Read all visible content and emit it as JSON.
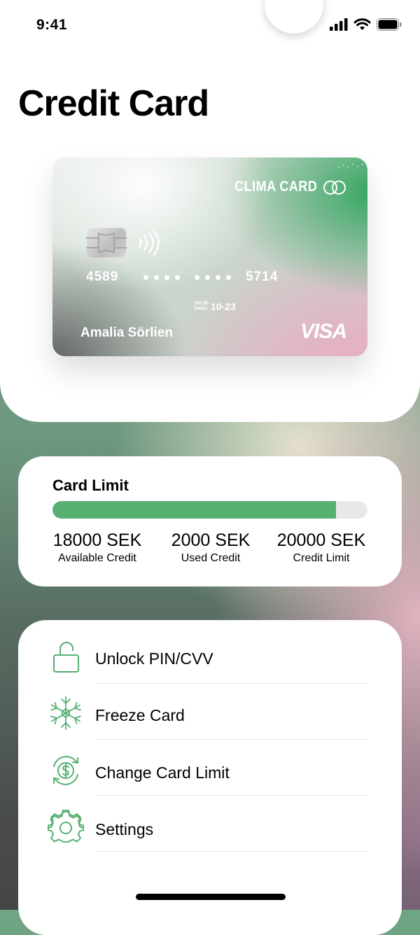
{
  "status_bar": {
    "time": "9:41"
  },
  "page": {
    "title": "Credit Card"
  },
  "card": {
    "brand": "CLIMA CARD",
    "number_first": "4589",
    "number_last": "5714",
    "valid_thru_label": "VALID THRU",
    "expiry": "10-23",
    "holder": "Amalia Sörlien",
    "network": "VISA",
    "colors": {
      "green": "#2ea45d",
      "pink": "#e8aec3",
      "gray": "#5c5e5e"
    }
  },
  "limit": {
    "title": "Card Limit",
    "fill_fraction": 0.9,
    "fill_color": "#55b072",
    "stats": [
      {
        "value": "18000 SEK",
        "label": "Available Credit"
      },
      {
        "value": "2000 SEK",
        "label": "Used Credit"
      },
      {
        "value": "20000 SEK",
        "label": "Credit Limit"
      }
    ]
  },
  "menu": {
    "accent": "#55b072",
    "items": [
      {
        "label": "Unlock PIN/CVV",
        "icon": "unlock-icon"
      },
      {
        "label": "Freeze Card",
        "icon": "snowflake-icon"
      },
      {
        "label": "Change Card Limit",
        "icon": "dollar-cycle-icon"
      },
      {
        "label": "Settings",
        "icon": "gear-icon"
      }
    ]
  }
}
